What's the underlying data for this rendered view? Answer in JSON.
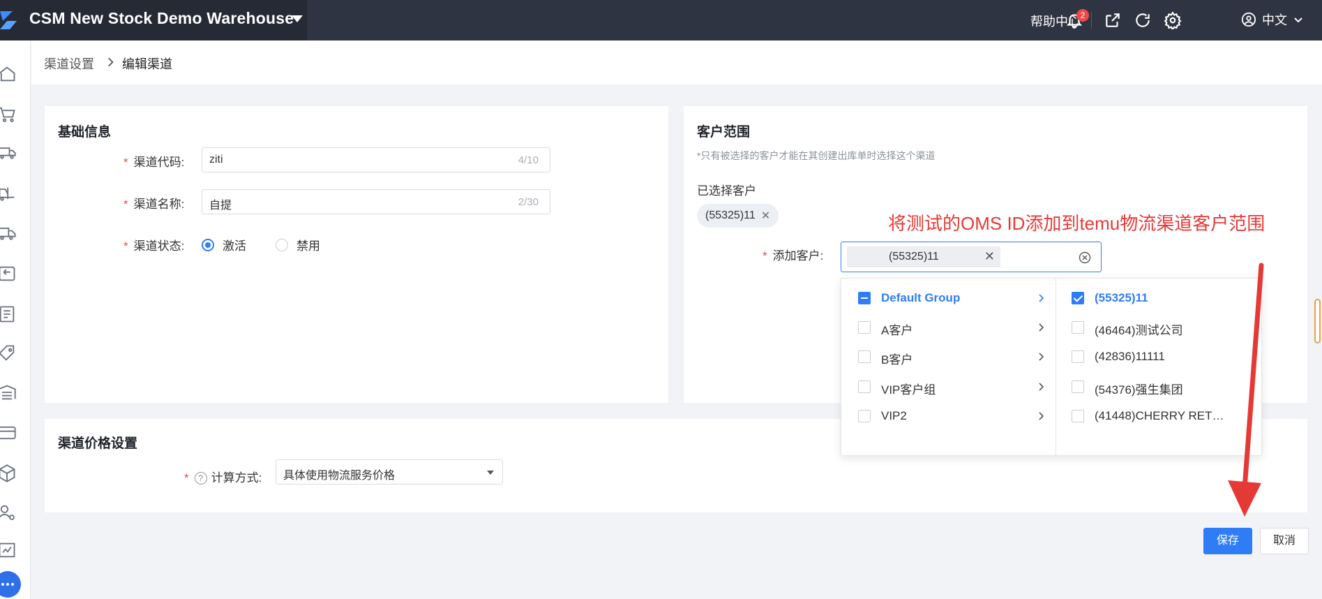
{
  "header": {
    "warehouse_name": "CSM New Stock Demo Warehouse",
    "help_center": "帮助中心",
    "notification_count": "2",
    "language": "中文"
  },
  "breadcrumb": {
    "parent": "渠道设置",
    "current": "编辑渠道"
  },
  "basic_info": {
    "title": "基础信息",
    "code_label": "渠道代码:",
    "code_value": "ziti",
    "code_count": "4/10",
    "name_label": "渠道名称:",
    "name_value": "自提",
    "name_count": "2/30",
    "status_label": "渠道状态:",
    "status_options": [
      "激活",
      "禁用"
    ],
    "status_selected": "激活"
  },
  "customer_scope": {
    "title": "客户范围",
    "hint": "*只有被选择的客户才能在其创建出库单时选择这个渠道",
    "selected_label": "已选择客户",
    "selected_tag": "(55325)11",
    "add_label": "添加客户:",
    "add_value": "(55325)11"
  },
  "annotation": "将测试的OMS ID添加到temu物流渠道客户范围",
  "cascader": {
    "groups": [
      {
        "label": "Default Group",
        "state": "indeterminate",
        "active": true
      },
      {
        "label": "A客户",
        "state": "unchecked",
        "active": false
      },
      {
        "label": "B客户",
        "state": "unchecked",
        "active": false
      },
      {
        "label": "VIP客户组",
        "state": "unchecked",
        "active": false
      },
      {
        "label": "VIP2",
        "state": "unchecked",
        "active": false
      }
    ],
    "customers": [
      {
        "label": "(55325)11",
        "state": "checked"
      },
      {
        "label": "(46464)测试公司",
        "state": "unchecked"
      },
      {
        "label": "(42836)11111",
        "state": "unchecked"
      },
      {
        "label": "(54376)强生集团",
        "state": "unchecked"
      },
      {
        "label": "(41448)CHERRY RET…",
        "state": "unchecked"
      }
    ]
  },
  "price_settings": {
    "title": "渠道价格设置",
    "calc_label": "计算方式:",
    "calc_value": "具体使用物流服务价格"
  },
  "actions": {
    "save": "保存",
    "cancel": "取消"
  },
  "colors": {
    "primary": "#2f7df6",
    "topbar": "#2f3442",
    "annotation": "#e53935"
  }
}
